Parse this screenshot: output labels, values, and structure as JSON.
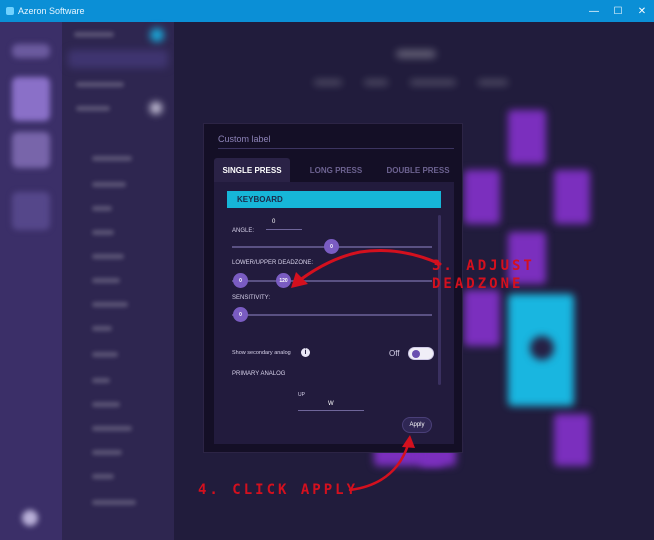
{
  "window": {
    "title": "Azeron Software",
    "controls": [
      "—",
      "☐",
      "✕"
    ]
  },
  "dialog": {
    "label": "Custom label",
    "tabs": [
      {
        "label": "SINGLE PRESS",
        "active": true
      },
      {
        "label": "LONG PRESS",
        "active": false
      },
      {
        "label": "DOUBLE PRESS",
        "active": false
      }
    ],
    "keyboard_label": "KEYBOARD",
    "angle": {
      "label": "ANGLE:",
      "value": "0",
      "slider_value": "0"
    },
    "deadzone": {
      "label": "LOWER/UPPER DEADZONE:",
      "lower": "0",
      "upper": "120"
    },
    "sensitivity": {
      "label": "SENSITIVITY:",
      "value": "0"
    },
    "secondary_analog": {
      "label": "Show secondary analog",
      "state": "Off"
    },
    "primary_analog": {
      "label": "PRIMARY ANALOG",
      "direction": "UP",
      "key": "W"
    },
    "apply_label": "Apply"
  },
  "annotations": {
    "step3_line1": "3. ADJUST",
    "step3_line2": "DEADZONE",
    "step4": "4. CLICK APPLY"
  },
  "colors": {
    "titlebar": "#0b8fd6",
    "accent_cyan": "#16b6d8",
    "knob_purple": "#7a5cc2",
    "annotation_red": "#d4101e",
    "tile_purple": "#7b2fbe",
    "tile_cyan": "#19b6e0"
  }
}
